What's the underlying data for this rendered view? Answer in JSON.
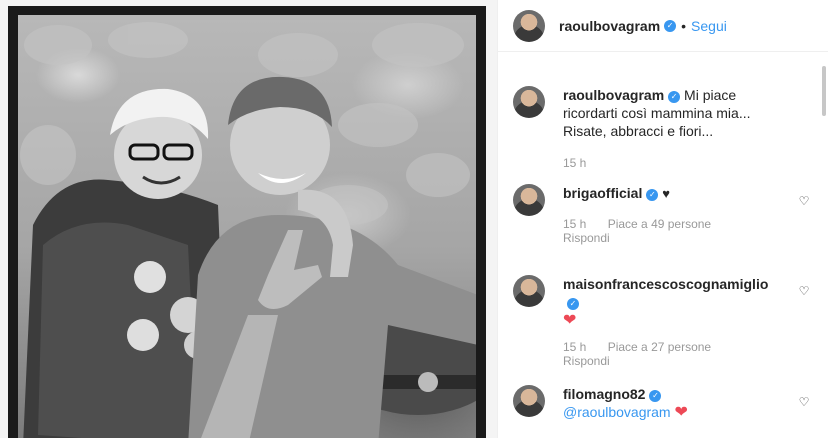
{
  "post": {
    "author": "raoulbovagram",
    "dot": "•",
    "follow_label": "Segui",
    "caption_line1": "Mi piace",
    "caption_line2": "ricordarti così mammina mia...",
    "caption_line3": "Risate, abbracci e fiori...",
    "time": "15 h"
  },
  "comments": [
    {
      "user": "brigaofficial",
      "time": "15 h",
      "likes": "Piace a 49 persone",
      "reply": "Rispondi",
      "emoji": "heart-black"
    },
    {
      "user": "maisonfrancescoscognamiglio",
      "time": "15 h",
      "likes": "Piace a 27 persone",
      "reply": "Rispondi",
      "emoji": "heart-red"
    },
    {
      "user": "filomagno82",
      "mention": "@raoulbovagram",
      "emoji": "heart-red"
    }
  ],
  "glyphs": {
    "check": "✓",
    "heart_outline": "♡",
    "heart_solid": "♥",
    "heart_red": "❤"
  },
  "colors": {
    "link": "#3897f0",
    "verified": "#3897f0",
    "heart": "#ed4956",
    "muted": "#999999"
  }
}
